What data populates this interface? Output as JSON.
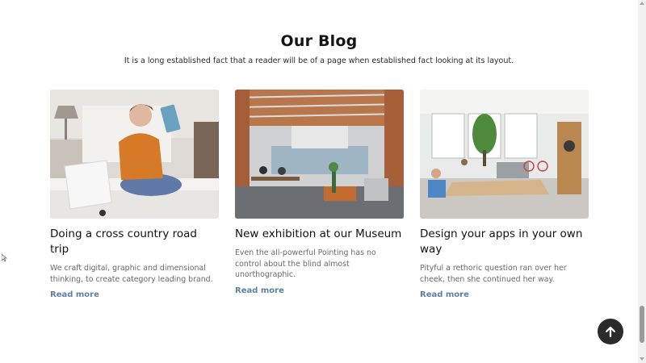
{
  "section": {
    "title": "Our Blog",
    "subtitle": "It is a long established fact that a reader will be of a page when established fact looking at its layout."
  },
  "posts": [
    {
      "title": "Doing a cross country road trip",
      "excerpt": "We craft digital, graphic and dimensional thinking, to create category leading brand.",
      "link": "Read more",
      "image": "woman-reading-on-bed"
    },
    {
      "title": "New exhibition at our Museum",
      "excerpt": "Even the all-powerful Pointing has no control about the blind almost unorthographic.",
      "link": "Read more",
      "image": "open-office-interior"
    },
    {
      "title": "Design your apps in your own way",
      "excerpt": "Pityful a rethoric question ran over her cheek, then she continued her way.",
      "link": "Read more",
      "image": "bright-coworking-space"
    }
  ],
  "back_to_top": {
    "icon": "arrow-up-icon"
  },
  "colors": {
    "link": "#5d7fa6",
    "button": "#2b2b2b"
  }
}
